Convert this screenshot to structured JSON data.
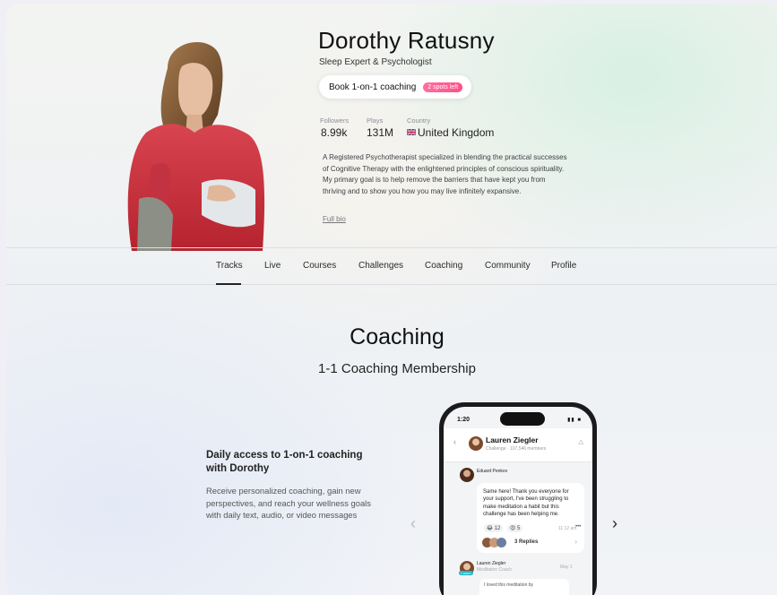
{
  "profile": {
    "name": "Dorothy Ratusny",
    "role": "Sleep Expert & Psychologist",
    "book_label": "Book 1-on-1 coaching",
    "spots_label": "2 spots left",
    "stats": [
      {
        "label": "Followers",
        "value": "8.99k"
      },
      {
        "label": "Plays",
        "value": "131M"
      },
      {
        "label": "Country",
        "value": "United Kingdom"
      }
    ],
    "bio": "A Registered Psychotherapist specialized in blending the practical successes of Cognitive Therapy with the enlightened principles of conscious spirituality. My primary goal is to help remove the barriers that have kept you from thriving and to show you how you may live infinitely expansive.",
    "full_bio_label": "Full bio"
  },
  "tabs": [
    {
      "label": "Tracks",
      "active": true
    },
    {
      "label": "Live"
    },
    {
      "label": "Courses"
    },
    {
      "label": "Challenges"
    },
    {
      "label": "Coaching"
    },
    {
      "label": "Community"
    },
    {
      "label": "Profile"
    }
  ],
  "section": {
    "title": "Coaching",
    "subtitle": "1-1 Coaching Membership",
    "feature_title": "Daily access to 1-on-1 coaching with Dorothy",
    "feature_desc": "Receive personalized coaching, gain new perspectives, and reach your wellness goals with daily text, audio, or video messages"
  },
  "phone": {
    "time": "1:20",
    "chat_name": "Lauren Ziegler",
    "chat_sub": "Challenge · 107,546 members",
    "sender1": "Eduard Penkov",
    "message1": "Same here! Thank you everyone for your support, I've been struggling to make meditation a habit but this challenge has been helping me.",
    "react1": "12",
    "react2": "5",
    "msg_time": "11:12 am",
    "replies": "3 Replies",
    "sender2": "Lauren Ziegler",
    "sender2_role": "Meditation Coach",
    "msg2_date": "May 1",
    "coach_badge": "Coach",
    "message2": "I loved this meditation by"
  },
  "colors": {
    "accent_pink": "#ff4f86",
    "coach_badge": "#19b7c9",
    "text_primary": "#111111"
  }
}
